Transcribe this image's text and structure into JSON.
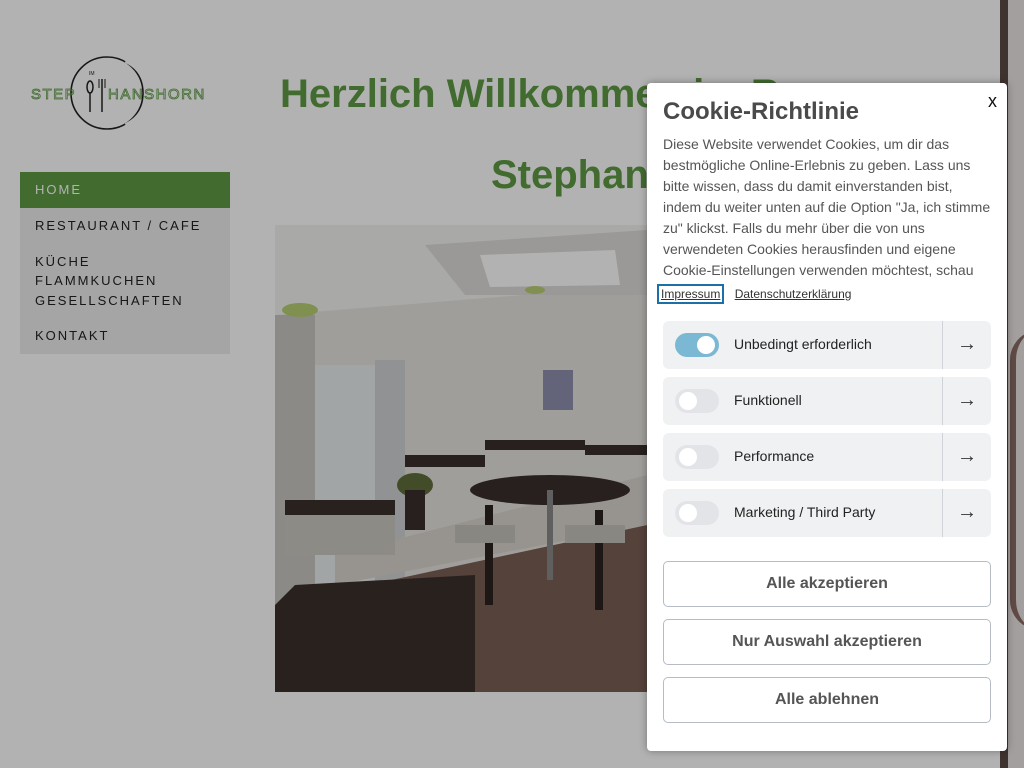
{
  "logo": {
    "text_left": "STEP",
    "text_right": "HANSHORN",
    "text_small": "IM"
  },
  "nav": {
    "items": [
      {
        "label": "HOME",
        "active": true
      },
      {
        "label": "RESTAURANT / CAFE"
      },
      {
        "label": "KÜCHE"
      },
      {
        "label": "FLAMMKUCHEN"
      },
      {
        "label": "GESELLSCHAFTEN"
      },
      {
        "label": "KONTAKT"
      }
    ]
  },
  "main": {
    "heading_line1": "Herzlich Willkommen im Ra",
    "heading_line2": "Stephan"
  },
  "cookie": {
    "close": "x",
    "title": "Cookie-Richtlinie",
    "description": "Diese Website verwendet Cookies, um dir das bestmögliche Online-Erlebnis zu geben. Lass uns bitte wissen, dass du damit einverstanden bist, indem du weiter unten auf die Option \"Ja, ich stimme zu\" klickst. Falls du mehr über die von uns verwendeten Cookies herausfinden und eigene Cookie-Einstellungen verwenden möchtest, schau",
    "link_impressum": "Impressum",
    "link_privacy": "Datenschutzerklärung",
    "categories": [
      {
        "label": "Unbedingt erforderlich",
        "enabled": true
      },
      {
        "label": "Funktionell",
        "enabled": false
      },
      {
        "label": "Performance",
        "enabled": false
      },
      {
        "label": "Marketing / Third Party",
        "enabled": false
      }
    ],
    "buttons": {
      "accept_all": "Alle akzeptieren",
      "accept_selection": "Nur Auswahl akzeptieren",
      "reject_all": "Alle ablehnen"
    },
    "arrow_icon": "→"
  },
  "colors": {
    "accent_green": "#5d9a44",
    "toggle_on": "#7ab8d4"
  }
}
